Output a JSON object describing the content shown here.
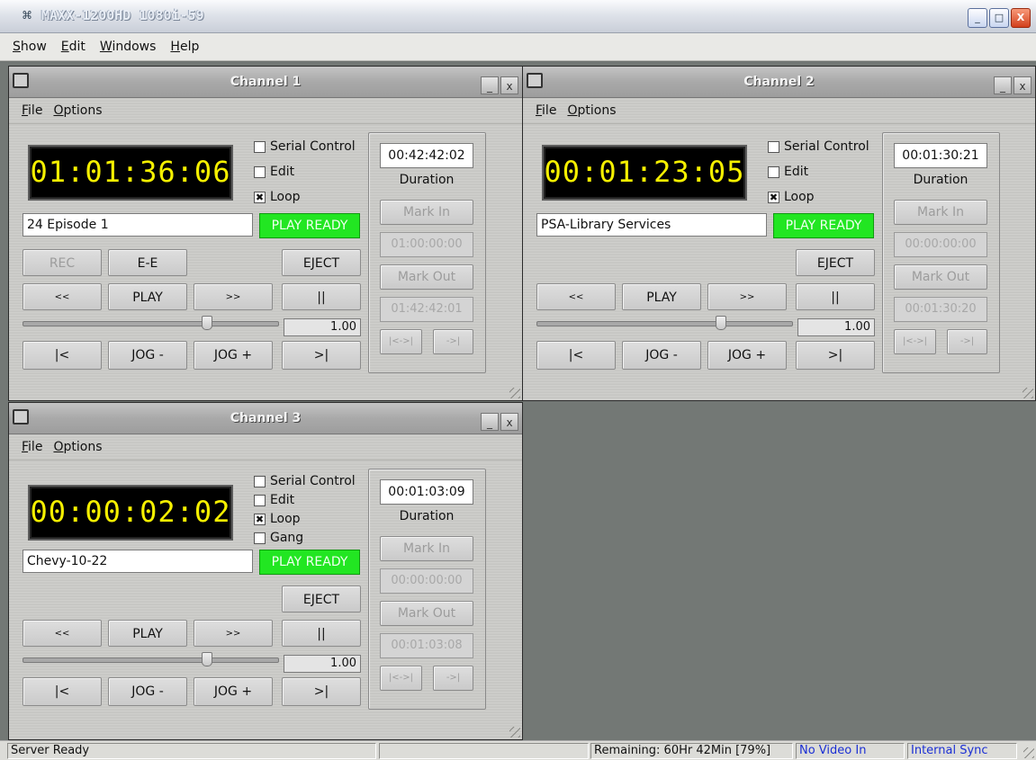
{
  "app": {
    "title": "MAXX-1200HD 1080i-59",
    "logo_glyph": "⌘",
    "minimize": "_",
    "maximize": "□",
    "close": "X"
  },
  "menu": [
    {
      "label": "Show",
      "mnemonic": "S"
    },
    {
      "label": "Edit",
      "mnemonic": "E"
    },
    {
      "label": "Windows",
      "mnemonic": "W"
    },
    {
      "label": "Help",
      "mnemonic": "H"
    }
  ],
  "channel_menu": {
    "file": "File",
    "options": "Options"
  },
  "labels": {
    "serial_control": "Serial Control",
    "edit": "Edit",
    "loop": "Loop",
    "gang": "Gang",
    "duration": "Duration",
    "mark_in": "Mark In",
    "mark_out": "Mark Out",
    "goto_marks": "|<->|",
    "goto_out": "->|",
    "rec": "REC",
    "ee": "E-E",
    "eject": "EJECT",
    "rewind": "<<",
    "play": "PLAY",
    "ffwd": ">>",
    "pause": "||",
    "to_start": "|<",
    "jog_minus": "JOG -",
    "jog_plus": "JOG +",
    "to_end": ">|",
    "win_min": "_",
    "win_close": "x",
    "check_mark": "✖"
  },
  "channels": [
    {
      "title": "Channel 1",
      "timecode": "01:01:36:06",
      "clip": "24 Episode 1",
      "status": "PLAY READY",
      "duration": "00:42:42:02",
      "mark_in_tc": "01:00:00:00",
      "mark_out_tc": "01:42:42:01",
      "speed": "1.00",
      "serial_control": false,
      "edit": false,
      "loop": true,
      "slider_position": 0.72
    },
    {
      "title": "Channel 2",
      "timecode": "00:01:23:05",
      "clip": "PSA-Library Services",
      "status": "PLAY READY",
      "duration": "00:01:30:21",
      "mark_in_tc": "00:00:00:00",
      "mark_out_tc": "00:01:30:20",
      "speed": "1.00",
      "serial_control": false,
      "edit": false,
      "loop": true,
      "slider_position": 0.72
    },
    {
      "title": "Channel 3",
      "timecode": "00:00:02:02",
      "clip": "Chevy-10-22",
      "status": "PLAY READY",
      "duration": "00:01:03:09",
      "mark_in_tc": "00:00:00:00",
      "mark_out_tc": "00:01:03:08",
      "speed": "1.00",
      "serial_control": false,
      "edit": false,
      "loop": true,
      "gang": false,
      "slider_position": 0.72
    }
  ],
  "statusbar": {
    "server": "Server Ready",
    "blank": "",
    "remaining": "Remaining: 60Hr 42Min  [79%]",
    "video": "No Video In",
    "sync": "Internal Sync"
  },
  "colors": {
    "status_green": "#22e622",
    "timecode_yellow": "#f6f000",
    "status_blue_text": "#1b2fd4"
  }
}
